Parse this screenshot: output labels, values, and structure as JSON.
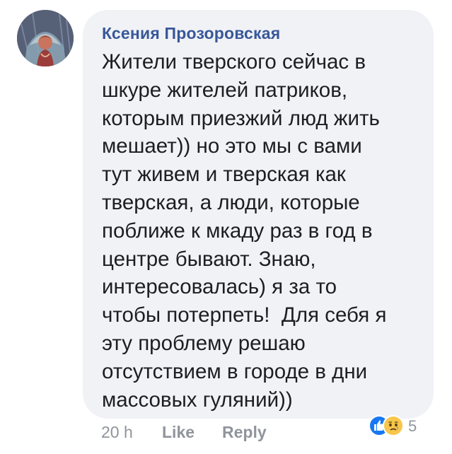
{
  "comment": {
    "author": "Ксения Прозоровская",
    "body_lines": [
      "Жители тверского сейчас в",
      "шкуре жителей патриков,",
      "которым приезжий люд жить",
      "мешает)) но это мы с вами",
      "тут живем и тверская как",
      "тверская, а люди, которые",
      "поближе к мкаду раз в год в",
      "центре бывают. Знаю,",
      "интересовалась) я за то",
      "чтобы потерпеть!  Для себя я",
      "эту проблему решаю",
      "отсутствием в городе в дни",
      "массовых гуляний))"
    ],
    "timestamp": "20 h",
    "like_label": "Like",
    "reply_label": "Reply",
    "reactions": {
      "icons": [
        "like-reaction-icon",
        "sad-reaction-icon"
      ],
      "count": "5"
    }
  },
  "colors": {
    "bubble": "#f1f2f6",
    "author": "#385898",
    "text": "#1c1e21",
    "meta": "#90949c",
    "like_reaction": "#1877f2",
    "sad_reaction": "#f7c64b"
  }
}
